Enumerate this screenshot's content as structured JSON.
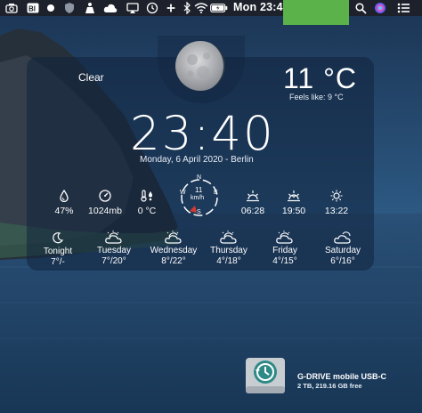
{
  "menubar": {
    "clock": "Mon 23:40",
    "icons": [
      "camera-icon",
      "bi-app-icon",
      "bluetooth-dot-icon",
      "shield-icon",
      "puppet-icon",
      "cloud-upload-icon",
      "screen-mirror-icon",
      "time-machine-icon",
      "fan-icon",
      "bluetooth-icon",
      "wifi-icon",
      "battery-icon",
      "flag-icon",
      "search-icon",
      "siri-icon",
      "notification-center-icon"
    ]
  },
  "weather": {
    "condition": "Clear",
    "temperature": "11 °C",
    "feels_like": "Feels like:  9 °C",
    "time": "23:40",
    "date": "Monday, 6 April 2020 - Berlin",
    "stats": [
      {
        "icon": "humidity-drop-icon",
        "value": "47%"
      },
      {
        "icon": "pressure-gauge-icon",
        "value": "1024mb"
      },
      {
        "icon": "dew-point-thermometer-icon",
        "value": "0 °C"
      },
      {
        "icon": "sunrise-icon",
        "value": "06:28"
      },
      {
        "icon": "sunset-icon",
        "value": "19:50"
      },
      {
        "icon": "solar-noon-icon",
        "value": "13:22"
      }
    ],
    "wind": {
      "speed": "11",
      "unit": "km/h",
      "n": "N",
      "e": "E",
      "s": "S",
      "w": "W"
    },
    "forecast": [
      {
        "day": "Tonight",
        "temps": "7°/-",
        "icon": "moon-icon"
      },
      {
        "day": "Tuesday",
        "temps": "7°/20°",
        "icon": "partly-cloudy-icon"
      },
      {
        "day": "Wednesday",
        "temps": "8°/22°",
        "icon": "partly-cloudy-icon"
      },
      {
        "day": "Thursday",
        "temps": "4°/18°",
        "icon": "partly-cloudy-icon"
      },
      {
        "day": "Friday",
        "temps": "4°/15°",
        "icon": "partly-cloudy-icon"
      },
      {
        "day": "Saturday",
        "temps": "6°/16°",
        "icon": "cloudy-icon"
      }
    ]
  },
  "desktop": {
    "drive_name": "G-DRIVE mobile USB-C",
    "drive_info": "2 TB, 219.16 GB free"
  },
  "colors": {
    "menubar": "#1c2028",
    "highlight_green": "#5bb24a",
    "widget_bg": "#10223c",
    "compass_accent": "#d23a2e"
  }
}
